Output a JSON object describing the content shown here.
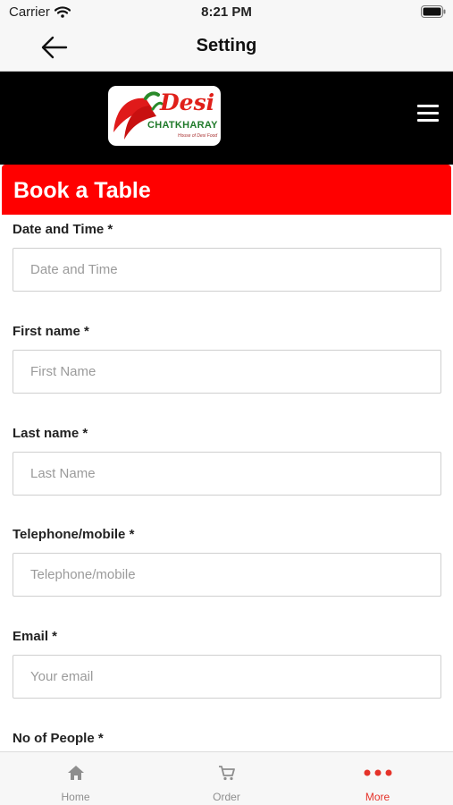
{
  "status_bar": {
    "carrier": "Carrier",
    "time": "8:21 PM"
  },
  "nav": {
    "title": "Setting"
  },
  "logo": {
    "brand_main": "Desi",
    "brand_sub": "CHATKHARAY",
    "tagline": "House of Desi Food"
  },
  "form": {
    "title": "Book a Table",
    "fields": [
      {
        "label": "Date and Time *",
        "placeholder": "Date and Time"
      },
      {
        "label": "First name *",
        "placeholder": "First Name"
      },
      {
        "label": "Last name *",
        "placeholder": "Last Name"
      },
      {
        "label": "Telephone/mobile *",
        "placeholder": "Telephone/mobile"
      },
      {
        "label": "Email *",
        "placeholder": "Your email"
      },
      {
        "label": "No of People *"
      }
    ]
  },
  "tabs": [
    {
      "label": "Home",
      "icon": "home-icon"
    },
    {
      "label": "Order",
      "icon": "cart-icon"
    },
    {
      "label": "More",
      "icon": "more-icon",
      "active": true
    }
  ],
  "colors": {
    "accent": "#ff0000",
    "active_tab": "#e5332a",
    "header_bg": "#000000"
  }
}
